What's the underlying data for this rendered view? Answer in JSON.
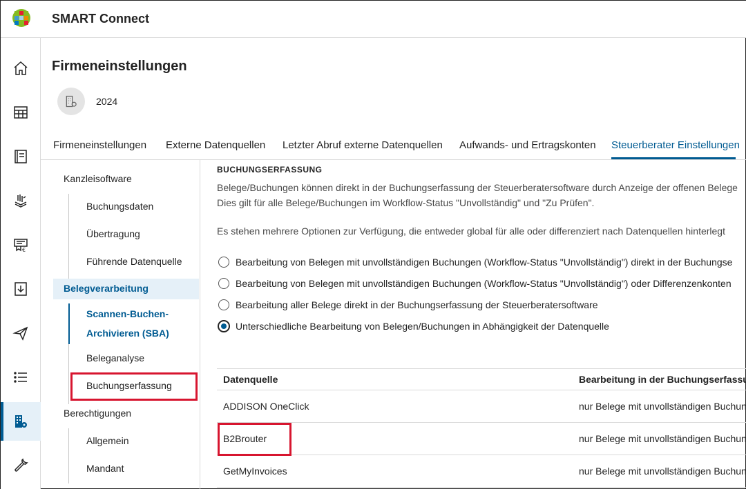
{
  "app": {
    "title": "SMART Connect"
  },
  "page": {
    "title": "Firmeneinstellungen",
    "company": "2024"
  },
  "rail": {
    "items": [
      {
        "icon": "home-icon",
        "active": false
      },
      {
        "icon": "table-icon",
        "active": false
      },
      {
        "icon": "book-icon",
        "active": false
      },
      {
        "icon": "document-stack-icon",
        "active": false
      },
      {
        "icon": "invoice-euro-icon",
        "active": false
      },
      {
        "icon": "download-icon",
        "active": false
      },
      {
        "icon": "send-icon",
        "active": false
      },
      {
        "icon": "list-icon",
        "active": false
      },
      {
        "icon": "company-settings-icon",
        "active": true
      },
      {
        "icon": "wrench-icon",
        "active": false
      }
    ]
  },
  "tabs": [
    {
      "label": "Firmeneinstellungen"
    },
    {
      "label": "Externe Datenquellen"
    },
    {
      "label": "Letzter Abruf externe Datenquellen"
    },
    {
      "label": "Aufwands- und Ertragskonten"
    },
    {
      "label": "Steuerberater Einstellungen",
      "active": true
    }
  ],
  "subnav": {
    "kanzleisoftware": "Kanzleisoftware",
    "buchungsdaten": "Buchungsdaten",
    "uebertragung": "Übertragung",
    "fuehrende": "Führende Datenquelle",
    "belegverarbeitung": "Belegverarbeitung",
    "sba_line1": "Scannen-Buchen-",
    "sba_line2": "Archivieren (SBA)",
    "beleganalyse": "Beleganalyse",
    "buchungserfassung": "Buchungserfassung",
    "berechtigungen": "Berechtigungen",
    "allgemein": "Allgemein",
    "mandant": "Mandant"
  },
  "content": {
    "section_title": "BUCHUNGSERFASSUNG",
    "para1_line1": "Belege/Buchungen können direkt in der Buchungserfassung der Steuerberatersoftware durch Anzeige der offenen Belege",
    "para1_line2": "Dies gilt für alle Belege/Buchungen im Workflow-Status \"Unvollständig\" und \"Zu Prüfen\".",
    "para2": "Es stehen mehrere Optionen zur Verfügung, die entweder global für alle oder differenziert nach Datenquellen hinterlegt",
    "options": [
      {
        "label": "Bearbeitung von Belegen mit unvollständigen Buchungen (Workflow-Status \"Unvollständig\") direkt in der Buchungse",
        "checked": false
      },
      {
        "label": "Bearbeitung von Belegen mit unvollständigen Buchungen (Workflow-Status \"Unvollständig\") oder Differenzenkonten",
        "checked": false
      },
      {
        "label": "Bearbeitung aller Belege direkt in der Buchungserfassung der Steuerberatersoftware",
        "checked": false
      },
      {
        "label": "Unterschiedliche Bearbeitung von Belegen/Buchungen in Abhängigkeit der Datenquelle",
        "checked": true
      }
    ],
    "table": {
      "headers": [
        "Datenquelle",
        "Bearbeitung in der Buchungserfassung"
      ],
      "rows": [
        [
          "ADDISON OneClick",
          "nur Belege mit unvollständigen Buchun"
        ],
        [
          "B2Brouter",
          "nur Belege mit unvollständigen Buchun"
        ],
        [
          "GetMyInvoices",
          "nur Belege mit unvollständigen Buchun"
        ]
      ]
    }
  },
  "colors": {
    "accent": "#005b92",
    "highlight": "#d7152f"
  }
}
